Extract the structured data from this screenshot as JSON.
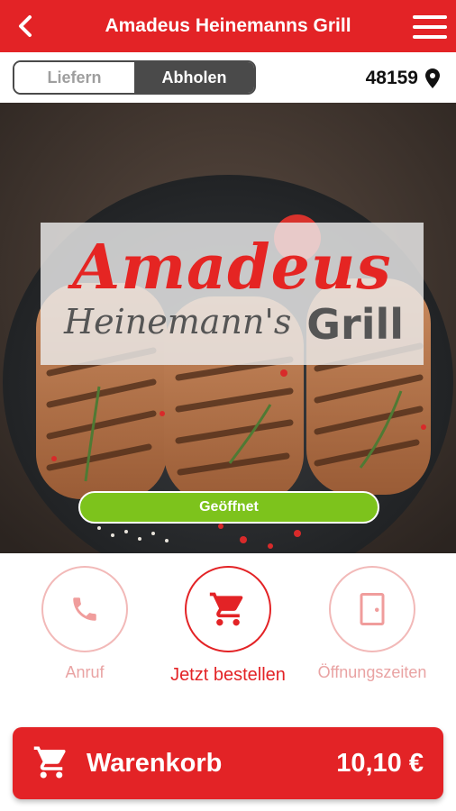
{
  "header": {
    "title": "Amadeus Heinemanns Grill",
    "back_icon": "chevron-left-icon",
    "menu_icon": "hamburger-menu-icon",
    "background_color": "#e32326"
  },
  "delivery_mode": {
    "options": [
      "Liefern",
      "Abholen"
    ],
    "selected": "Abholen",
    "postal_code": "48159",
    "location_icon": "map-pin-icon"
  },
  "hero": {
    "logo": {
      "main": "Amadeus",
      "sub": "Heinemann's",
      "grill": "Grill"
    },
    "status": "Geöffnet",
    "status_color": "#7dc31c"
  },
  "actions": [
    {
      "label": "Anruf",
      "icon": "phone-icon",
      "emphasized": false
    },
    {
      "label": "Jetzt bestellen",
      "icon": "shopping-cart-icon",
      "emphasized": true
    },
    {
      "label": "Öffnungszeiten",
      "icon": "door-icon",
      "emphasized": false
    }
  ],
  "cart": {
    "label": "Warenkorb",
    "total": "10,10 €",
    "icon": "shopping-cart-icon"
  }
}
